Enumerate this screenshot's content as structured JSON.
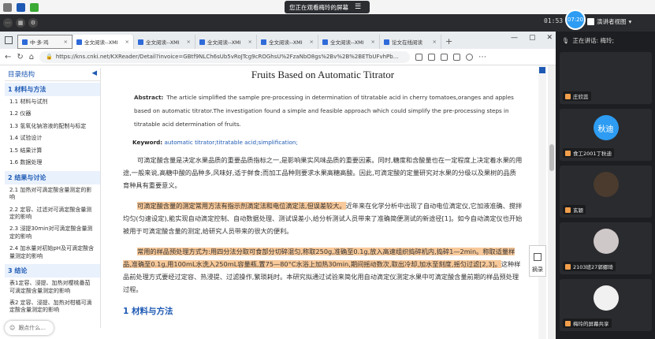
{
  "share_banner": {
    "text": "您正在观看梅玲的屏幕",
    "menu_icon": "menu-icon"
  },
  "top_bar": {
    "time": "01:53",
    "bubble_time": "07:20",
    "presenter_view_label": "演讲者视图"
  },
  "speaking": {
    "label": "正在讲话: 梅玲;"
  },
  "browser": {
    "tabs": [
      {
        "label": "中·多·鸡",
        "active": false
      },
      {
        "label": "全文阅读--XMI",
        "active": true
      },
      {
        "label": "全文阅读--XMI",
        "active": false
      },
      {
        "label": "全文阅读--XMI",
        "active": false
      },
      {
        "label": "全文阅读--XMI",
        "active": false
      },
      {
        "label": "全文阅读--XMI",
        "active": false
      },
      {
        "label": "论文在线阅读",
        "active": false
      }
    ],
    "url": "https://kns.cnki.net/KXReader/Detail?invoice=GBtf9NLCh6sUb5vRoJTcg9cROGhsU%2FzaNbO8gs%2Bv%2B%2BETbUFvhPb..."
  },
  "toc": {
    "heading": "目录结构",
    "collapse_arrow": "◀",
    "sections": [
      {
        "title": "1 材料与方法",
        "items": [
          "1.1 材料与试剂",
          "1.2 仪器",
          "1.3 氢氧化钠溶液的配制与标定",
          "1.4 试验设计",
          "1.5 结果计算",
          "1.6 数据处理"
        ]
      },
      {
        "title": "2 结果与讨论",
        "items": [
          "2.1 加热对可滴定酸含量测定的影响",
          "2.2 定容、过滤对可滴定酸含量测定的影响",
          "2.3 浸提30min对可滴定酸含量测定的影响",
          "2.4 加水量对初始pH及可滴定酸含量测定的影响"
        ]
      },
      {
        "title": "3 结论",
        "items": [
          "表1定容、浸提、加热对樱桃番茄可滴定酸含量测定的影响",
          "表2 定容、浸提、加热对柑橘可滴定酸含量测定的影响"
        ]
      }
    ],
    "float_placeholder": "跟点什么..."
  },
  "document": {
    "title": "Fruits Based on Automatic Titrator",
    "abstract_label": "Abstract:",
    "abstract_text": "The article simplified the sample pre-processing in determination of titratable acid in cherry tomatoes,oranges and apples based on automatic titrator.The investigation found a simple and feasible approach which could simplify the pre-processing steps in titratable acid determination of fruits.",
    "keywords_label": "Keyword:",
    "keywords": "automatic titrator;titratable acid;simplification;",
    "para1": "可滴定酸含量是决定水果品质的重要品质指标之一,是影响果实风味品质的重要因素。同时,糖度和含酸量也在一定程度上决定着水果的用途,一般来说,高糖中酸的品种多,风味好,适于鲜食;而加工品种则要求水果高糖高酸。因此,可滴定酸的定量研究对水果的分级以及果树的品质育种具有重要意义。",
    "para2_hl": "可滴定酸含量的测定常用方法有指示剂滴定法和电位滴定法,但误差较大。",
    "para2_rest": "近年来在化学分析中出现了自动电位滴定仪,它加液准确、搅拌均匀(匀速设定),能实现自动滴定控制、自动数据处理、测试误差小,给分析测试人员带来了准确简便测试的新途径[1]。如今自动滴定仪也开始被用于可滴定酸含量的测定,给研究人员带来的很大的便利。",
    "para3_hl": "常用的样品预处理方式为:用四分法分取可食部分切碎混匀,称取250g,准确至0.1g,放入高速组织捣碎机内,捣碎1—2min。称取适量样品,准确至0.1g,用100mL水洗入250mL容量瓶,置75—80°C水浴上加热30min,期间摇动数次,取出冷却,加水至刻度,摇匀过滤[2,3]。",
    "para3_rest": "这种样品前处理方式要经过定容、热浸提、过滤操作,繁琐耗时。本研究拟通过试验来简化用自动滴定仪测定水果中可滴定酸含量前期的样品预处理过程。",
    "heading1": "1 材料与方法",
    "summary_label": "摘录"
  },
  "participants": [
    {
      "name": "庄欣蕊",
      "avatar_text": "",
      "avatar_color": "#2a2b2e"
    },
    {
      "name": "食工2001丁秋迪",
      "avatar_text": "秋迪",
      "avatar_color": "#2d9cf2"
    },
    {
      "name": "玄颖",
      "avatar_text": "",
      "avatar_color": "#4a3b2e"
    },
    {
      "name": "2103班27郭娜琦",
      "avatar_text": "",
      "avatar_color": "#cfc8c8"
    },
    {
      "name": "梅玲的屏幕共享",
      "avatar_text": "",
      "avatar_color": "#f1f1f1"
    }
  ]
}
